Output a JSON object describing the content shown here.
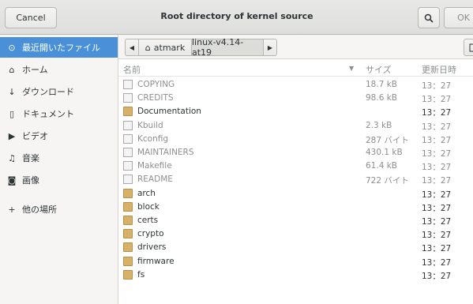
{
  "header": {
    "cancel_label": "Cancel",
    "title": "Root directory of kernel source",
    "ok_label": "OK"
  },
  "sidebar": {
    "items": [
      {
        "label": "最近開いたファイル",
        "icon": "clock-icon",
        "selected": true
      },
      {
        "label": "ホーム",
        "icon": "home-icon"
      },
      {
        "label": "ダウンロード",
        "icon": "download-icon"
      },
      {
        "label": "ドキュメント",
        "icon": "document-icon"
      },
      {
        "label": "ビデオ",
        "icon": "video-icon"
      },
      {
        "label": "音楽",
        "icon": "music-icon"
      },
      {
        "label": "画像",
        "icon": "camera-icon"
      },
      {
        "label": "他の場所",
        "icon": "plus-icon"
      }
    ]
  },
  "pathbar": {
    "home_segment": "atmark",
    "current_segment": "linux-v4.14-at19"
  },
  "columns": {
    "name": "名前",
    "size": "サイズ",
    "modified": "更新日時"
  },
  "files": [
    {
      "name": "COPYING",
      "size": "18.7 kB",
      "time": "13：27",
      "type": "file"
    },
    {
      "name": "CREDITS",
      "size": "98.6 kB",
      "time": "13：27",
      "type": "file"
    },
    {
      "name": "Documentation",
      "size": "",
      "time": "13：27",
      "type": "folder"
    },
    {
      "name": "Kbuild",
      "size": "2.3 kB",
      "time": "13：27",
      "type": "file"
    },
    {
      "name": "Kconfig",
      "size": "287 バイト",
      "time": "13：27",
      "type": "file"
    },
    {
      "name": "MAINTAINERS",
      "size": "430.1 kB",
      "time": "13：27",
      "type": "file"
    },
    {
      "name": "Makefile",
      "size": "61.4 kB",
      "time": "13：27",
      "type": "file"
    },
    {
      "name": "README",
      "size": "722 バイト",
      "time": "13：27",
      "type": "file"
    },
    {
      "name": "arch",
      "size": "",
      "time": "13：27",
      "type": "folder"
    },
    {
      "name": "block",
      "size": "",
      "time": "13：27",
      "type": "folder"
    },
    {
      "name": "certs",
      "size": "",
      "time": "13：27",
      "type": "folder"
    },
    {
      "name": "crypto",
      "size": "",
      "time": "13：27",
      "type": "folder"
    },
    {
      "name": "drivers",
      "size": "",
      "time": "13：27",
      "type": "folder"
    },
    {
      "name": "firmware",
      "size": "",
      "time": "13：27",
      "type": "folder"
    },
    {
      "name": "fs",
      "size": "",
      "time": "13：27",
      "type": "folder"
    }
  ],
  "colors": {
    "selected_bg": "#4a90d9",
    "folder": "#d6b16b",
    "dim_text": "#8b8e8f"
  }
}
